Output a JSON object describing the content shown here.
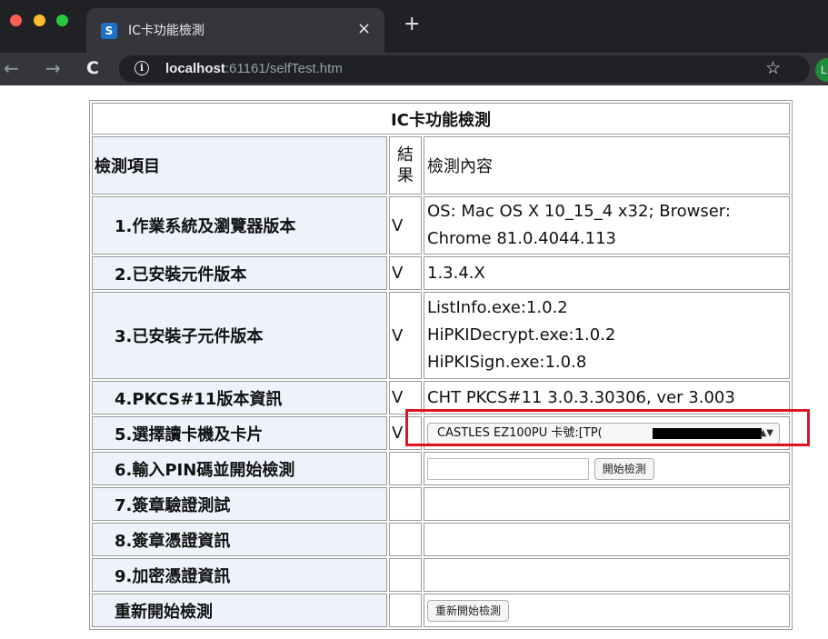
{
  "browser": {
    "tab_title": "IC卡功能檢測",
    "tab_close": "×",
    "new_tab": "+",
    "favicon": "S",
    "url_host": "localhost",
    "url_rest": ":61161/selfTest.htm",
    "back": "←",
    "forward": "→",
    "reload": "C",
    "info": "i",
    "star": "☆",
    "profile": "L"
  },
  "page": {
    "title": "IC卡功能檢測",
    "header": {
      "item": "檢測項目",
      "result": "結果",
      "content": "檢測內容"
    },
    "rows": [
      {
        "label": "1.作業系統及瀏覽器版本",
        "result": "V",
        "content": "OS: Mac OS X 10_15_4 x32;  Browser: Chrome 81.0.4044.113"
      },
      {
        "label": "2.已安裝元件版本",
        "result": "V",
        "content": "1.3.4.X"
      },
      {
        "label": "3.已安裝子元件版本",
        "result": "V",
        "content_lines": [
          "ListInfo.exe:1.0.2",
          "HiPKIDecrypt.exe:1.0.2",
          "HiPKISign.exe:1.0.8"
        ]
      },
      {
        "label": "4.PKCS#11版本資訊",
        "result": "V",
        "content": "CHT PKCS#11 3.0.3.30306, ver 3.003"
      },
      {
        "label": "5.選擇讀卡機及卡片",
        "result": "V",
        "select_value": "CASTLES EZ100PU 卡號:[TP("
      },
      {
        "label": "6.輸入PIN碼並開始檢測",
        "result": "",
        "button": "開始檢測"
      },
      {
        "label": "7.簽章驗證測試",
        "result": ""
      },
      {
        "label": "8.簽章憑證資訊",
        "result": ""
      },
      {
        "label": "9.加密憑證資訊",
        "result": ""
      },
      {
        "label": "重新開始檢測",
        "result": "",
        "button": "重新開始檢測"
      }
    ]
  },
  "colors": {
    "highlight": "#e0141e",
    "label_bg": "#eef3fb",
    "chrome_dark": "#202124"
  }
}
